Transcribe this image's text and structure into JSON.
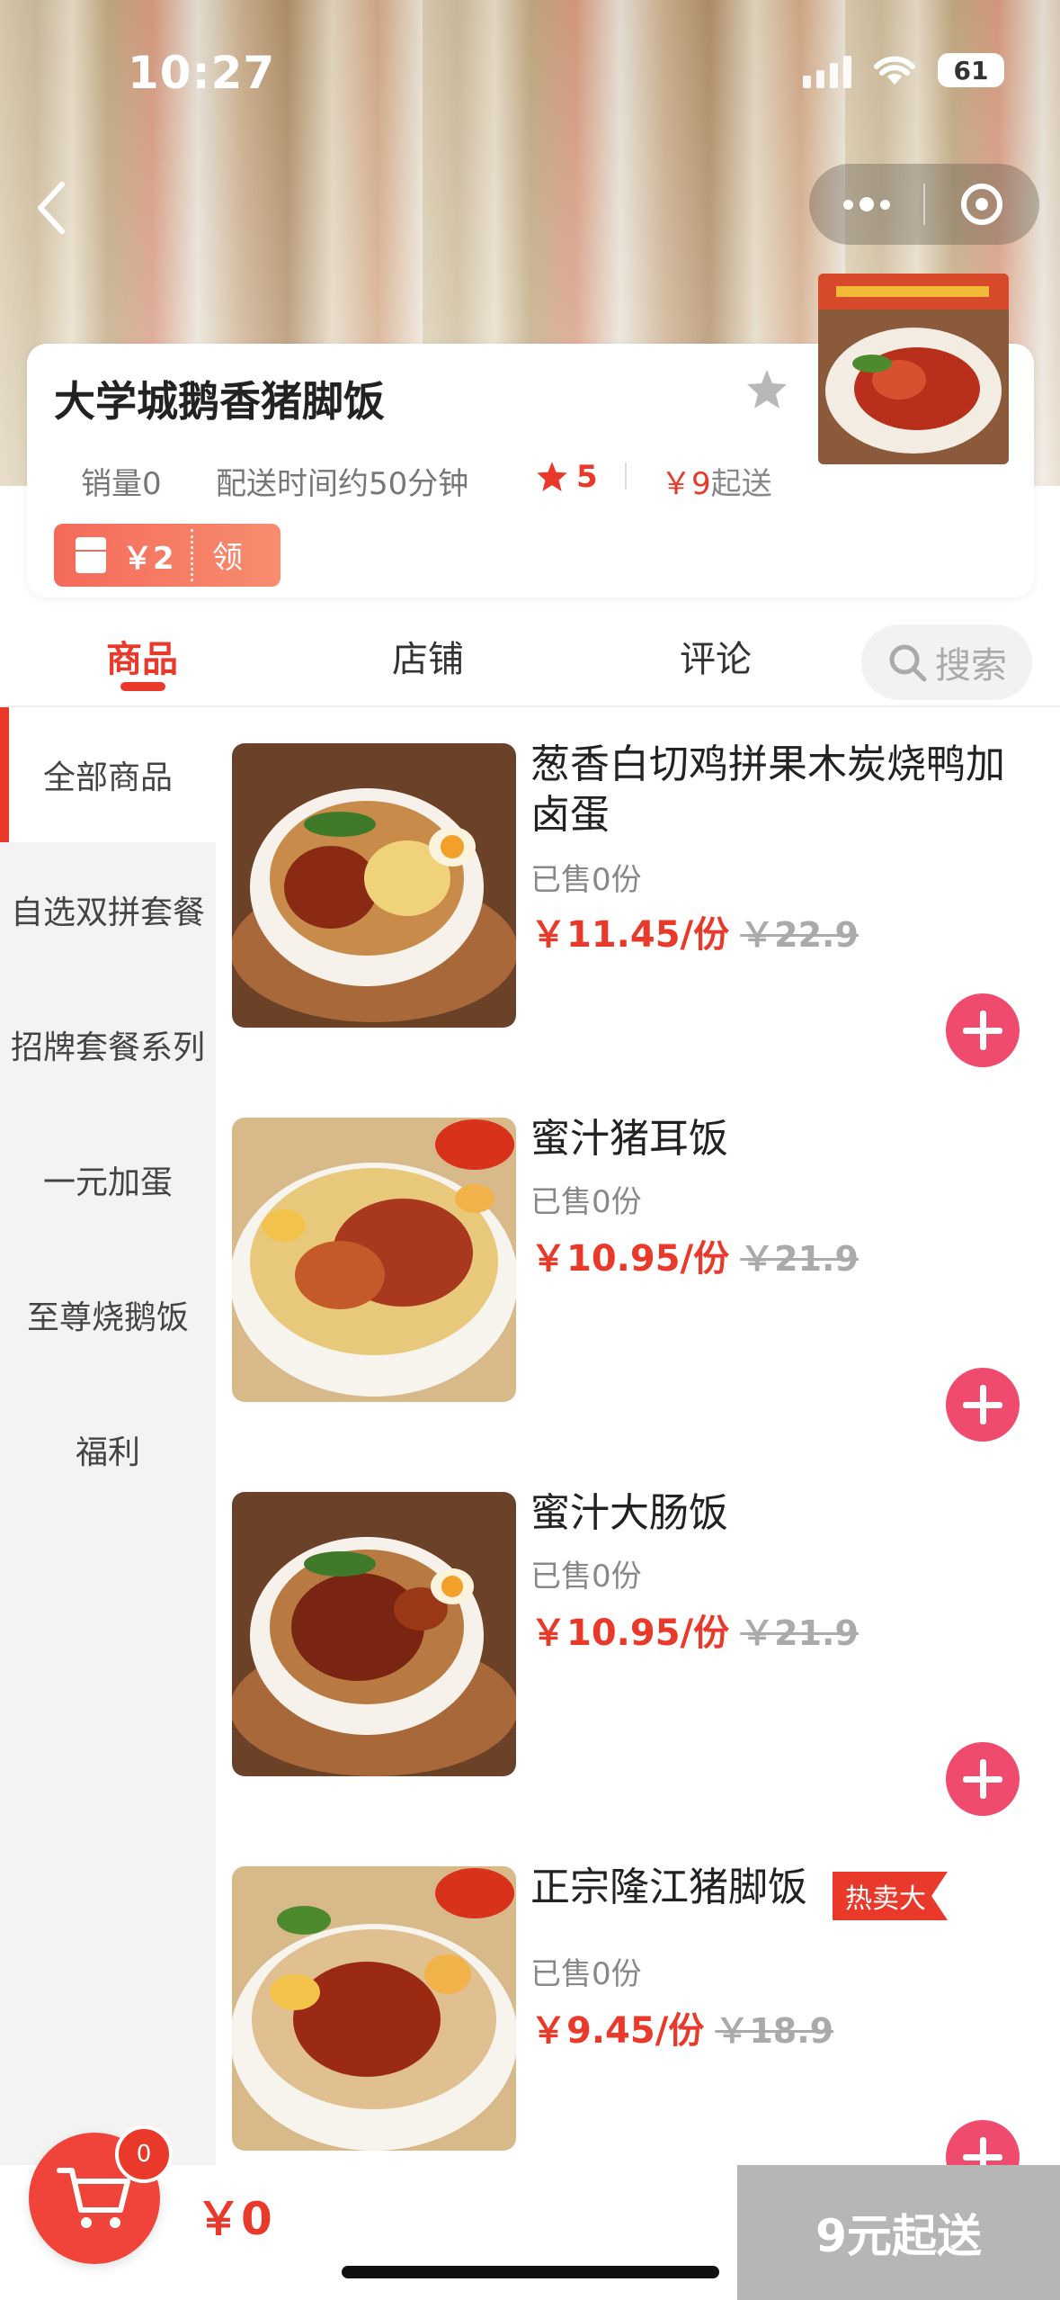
{
  "status_bar": {
    "time": "10:27",
    "battery": "61"
  },
  "shop": {
    "name": "大学城鹅香猪脚饭",
    "sales": "销量0",
    "delivery_time": "配送时间约50分钟",
    "rating": "5",
    "min_order_currency": "￥9",
    "min_order_suffix": "起送",
    "coupon": {
      "amount": "￥2",
      "action": "领"
    }
  },
  "tabs": [
    {
      "label": "商品"
    },
    {
      "label": "店铺"
    },
    {
      "label": "评论"
    }
  ],
  "search": {
    "label": "搜索"
  },
  "categories": [
    {
      "label": "全部商品"
    },
    {
      "label": "自选双拼套餐"
    },
    {
      "label": "招牌套餐系列"
    },
    {
      "label": "一元加蛋"
    },
    {
      "label": "至尊烧鹅饭"
    },
    {
      "label": "福利"
    }
  ],
  "products": [
    {
      "name": "葱香白切鸡拼果木炭烧鸭加卤蛋",
      "sold": "已售0份",
      "price": "￥11.45/份",
      "original_price": "￥22.9"
    },
    {
      "name": "蜜汁猪耳饭",
      "sold": "已售0份",
      "price": "￥10.95/份",
      "original_price": "￥21.9"
    },
    {
      "name": "蜜汁大肠饭",
      "sold": "已售0份",
      "price": "￥10.95/份",
      "original_price": "￥21.9"
    },
    {
      "name": "正宗隆江猪脚饭",
      "sold": "已售0份",
      "price": "￥9.45/份",
      "original_price": "￥18.9",
      "tag": "热卖大"
    }
  ],
  "cart": {
    "count": "0",
    "total": "￥0",
    "checkout_label": "9元起送"
  },
  "colors": {
    "accent": "#e8392a",
    "add_button": "#ee4b6e",
    "sidebar_bg": "#f3f3f3"
  }
}
